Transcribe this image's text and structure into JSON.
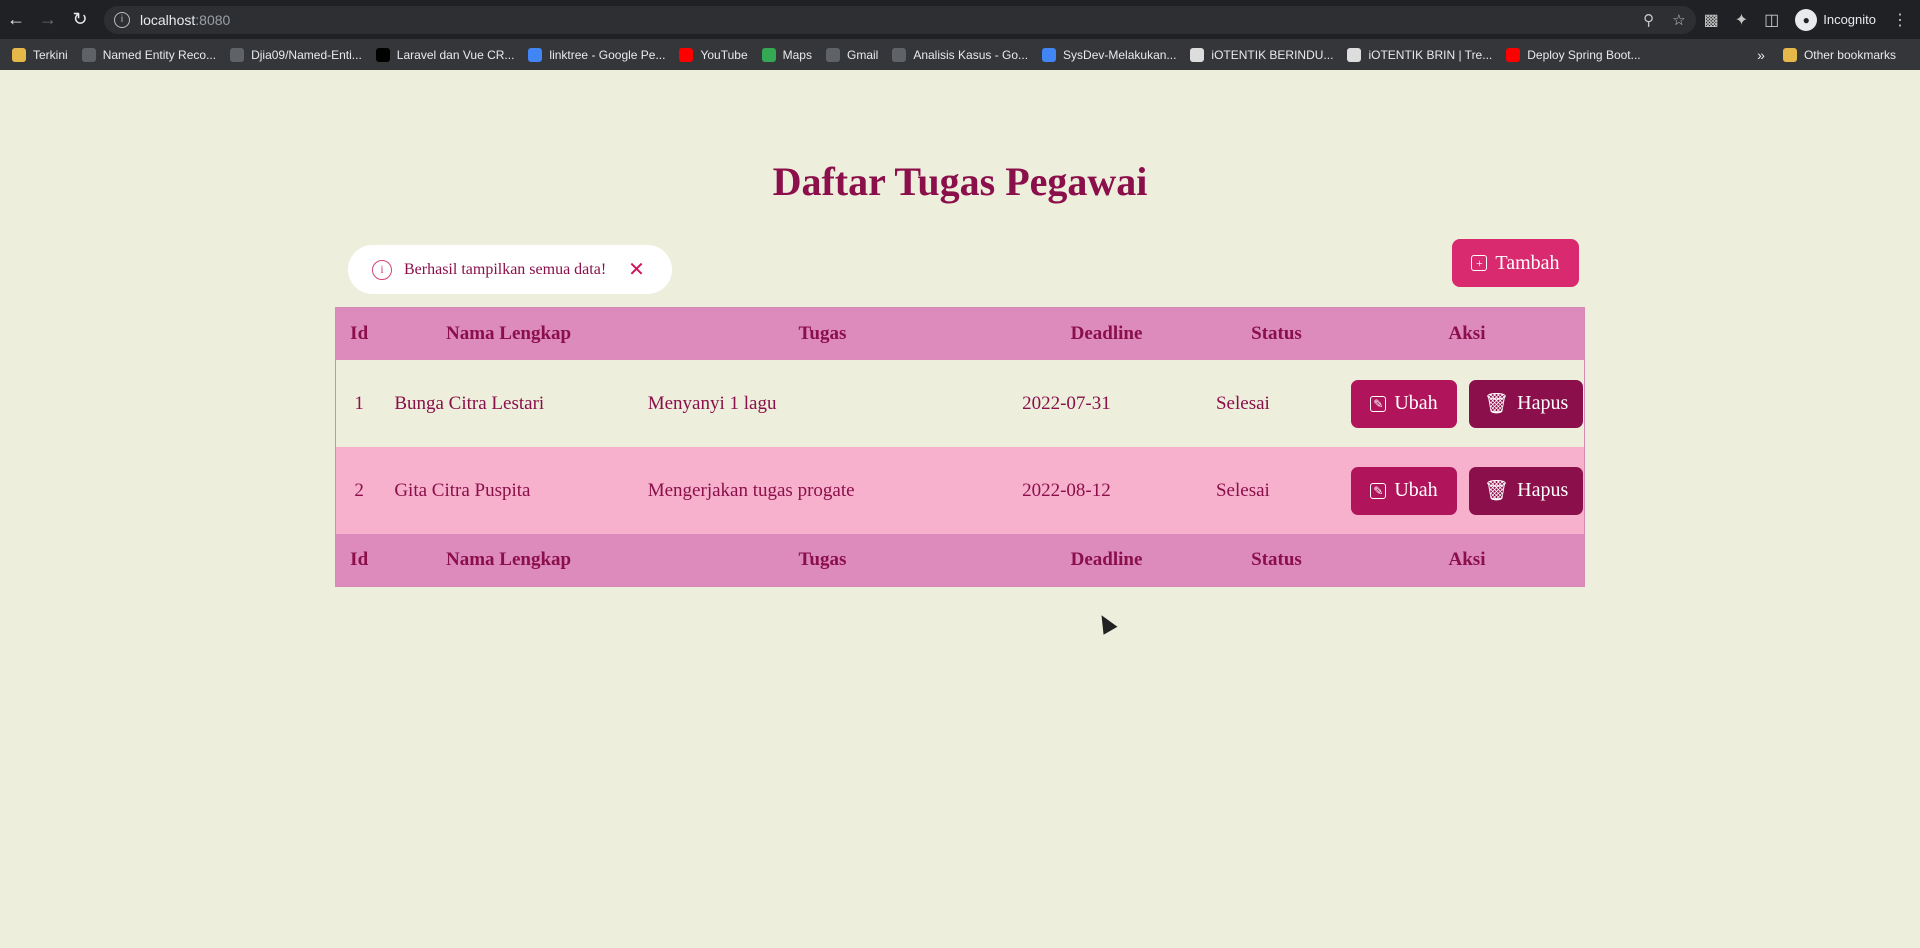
{
  "browser": {
    "url_host": "localhost",
    "url_port": ":8080",
    "profile_label": "Incognito",
    "bookmarks": [
      {
        "label": "Terkini",
        "color": "#e6b84a"
      },
      {
        "label": "Named Entity Reco...",
        "color": "#5f6368"
      },
      {
        "label": "Djia09/Named-Enti...",
        "color": "#5f6368"
      },
      {
        "label": "Laravel dan Vue CR...",
        "color": "#000000"
      },
      {
        "label": "linktree - Google Pe...",
        "color": "#4285f4"
      },
      {
        "label": "YouTube",
        "color": "#ff0000"
      },
      {
        "label": "Maps",
        "color": "#34a853"
      },
      {
        "label": "Gmail",
        "color": "#5f6368"
      },
      {
        "label": "Analisis Kasus - Go...",
        "color": "#5f6368"
      },
      {
        "label": "SysDev-Melakukan...",
        "color": "#4285f4"
      },
      {
        "label": "iOTENTIK BERINDU...",
        "color": "#dddddd"
      },
      {
        "label": "iOTENTIK BRIN | Tre...",
        "color": "#dddddd"
      },
      {
        "label": "Deploy Spring Boot...",
        "color": "#ff0000"
      }
    ],
    "other_bookmarks": "Other bookmarks"
  },
  "page": {
    "title": "Daftar Tugas Pegawai",
    "alert_text": "Berhasil tampilkan semua data!",
    "add_button": "Tambah"
  },
  "table": {
    "headers": [
      "Id",
      "Nama Lengkap",
      "Tugas",
      "Deadline",
      "Status",
      "Aksi"
    ],
    "rows": [
      {
        "id": "1",
        "name": "Bunga Citra Lestari",
        "task": "Menyanyi 1 lagu",
        "deadline": "2022-07-31",
        "status": "Selesai"
      },
      {
        "id": "2",
        "name": "Gita Citra Puspita",
        "task": "Mengerjakan tugas progate",
        "deadline": "2022-08-12",
        "status": "Selesai"
      }
    ],
    "edit_label": "Ubah",
    "delete_label": "Hapus"
  },
  "colors": {
    "background": "#eeeedc",
    "primary": "#8a0f4a",
    "accent": "#d9296f",
    "header_row": "#dd8bbd",
    "striped_row": "#f7b1cd"
  }
}
